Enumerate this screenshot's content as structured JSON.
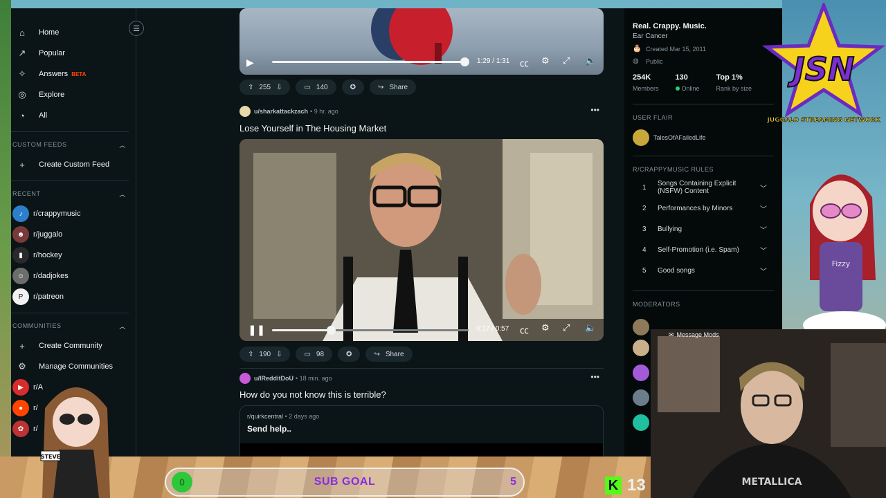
{
  "sidebar": {
    "nav": [
      {
        "label": "Home",
        "icon": "home-icon"
      },
      {
        "label": "Popular",
        "icon": "popular-icon"
      },
      {
        "label": "Answers",
        "icon": "answers-icon",
        "badge": "BETA"
      },
      {
        "label": "Explore",
        "icon": "explore-icon"
      },
      {
        "label": "All",
        "icon": "all-icon"
      }
    ],
    "custom_feeds_header": "CUSTOM FEEDS",
    "create_custom_feed": "Create Custom Feed",
    "recent_header": "RECENT",
    "recent": [
      {
        "label": "r/crappymusic",
        "color": "#2b7fcb"
      },
      {
        "label": "r/juggalo",
        "color": "#7b3a3a"
      },
      {
        "label": "r/hockey",
        "color": "#2a2a2a"
      },
      {
        "label": "r/dadjokes",
        "color": "#6d6d6d"
      },
      {
        "label": "r/patreon",
        "color": "#f2f2f2"
      }
    ],
    "communities_header": "COMMUNITIES",
    "create_community": "Create Community",
    "manage_communities": "Manage Communities",
    "communities_partial": [
      "r/A",
      "r/",
      "r/"
    ]
  },
  "feed": {
    "post1": {
      "time_current": "1:29",
      "time_total": "1:31",
      "progress": 0.98,
      "upvotes": "255",
      "comments": "140",
      "share": "Share"
    },
    "post2": {
      "user": "u/sharkattackzach",
      "age": "9 hr. ago",
      "title": "Lose Yourself in The Housing Market",
      "time_current": "0:17",
      "time_total": "0:57",
      "progress": 0.3,
      "upvotes": "190",
      "comments": "98",
      "share": "Share"
    },
    "post3": {
      "user": "u/IRedditDoU",
      "age": "18 min. ago",
      "title": "How do you not know this is terrible?",
      "crosspost_sub": "r/quirkcentral",
      "crosspost_age": "2 days ago",
      "crosspost_title": "Send help.."
    }
  },
  "right_sidebar": {
    "title": "Real. Crappy. Music.",
    "subtitle": "Ear Cancer",
    "created": "Created Mar 15, 2011",
    "visibility": "Public",
    "members_value": "254K",
    "members_label": "Members",
    "online_value": "130",
    "online_label": "Online",
    "rank_value": "Top 1%",
    "rank_label": "Rank by size",
    "user_flair_header": "USER FLAIR",
    "flair_name": "TalesOfAFailedLife",
    "rules_header": "R/CRAPPYMUSIC RULES",
    "rules": [
      {
        "num": "1",
        "text": "Songs Containing Explicit (NSFW) Content"
      },
      {
        "num": "2",
        "text": "Performances by Minors"
      },
      {
        "num": "3",
        "text": "Bullying"
      },
      {
        "num": "4",
        "text": "Self-Promotion (i.e. Spam)"
      },
      {
        "num": "5",
        "text": "Good songs"
      }
    ],
    "moderators_header": "MODERATORS",
    "message_mods": "Message Mods"
  },
  "overlay": {
    "logo_text": "JSN",
    "logo_tagline": "JUGGALO STREAMING NETWORK",
    "girl_shirt": "Fizzy",
    "sub_goal_label": "SUB GOAL",
    "sub_goal_current": "0",
    "sub_goal_target": "5",
    "kick_followers": "13",
    "kick_letter": "K",
    "left_char_tag": "STEVE",
    "cam_shirt": "METALLICA"
  }
}
